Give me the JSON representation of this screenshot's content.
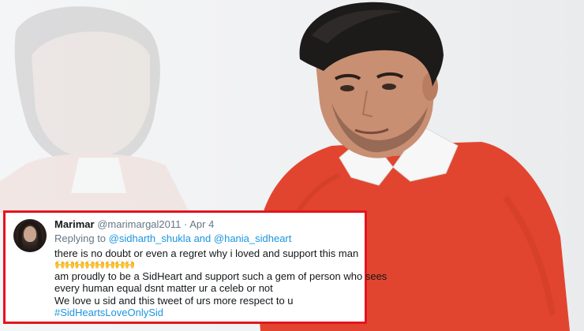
{
  "tweet": {
    "display_name": "Marimar",
    "handle": "@marimargal2011",
    "separator": "·",
    "date": "Apr 4",
    "replying_prefix": "Replying to",
    "mention_1": "@sidharth_shukla",
    "replying_joiner": "and",
    "mention_2": "@hania_sidheart",
    "line_1": "there is no doubt or even a regret why i loved and support this man",
    "emoji_row": "🙌🙌🙌🙌🙌🙌🙌🙌",
    "line_2": "am proudly to be a SidHeart and support such a gem of person who sees",
    "line_3": "every human equal dsnt matter ur a celeb or not",
    "line_4": "We love u sid and this tweet of urs more respect to u",
    "hashtag": "#SidHeartsLoveOnlySid"
  },
  "colors": {
    "card_border": "#e4141d",
    "link_blue": "#1b95e0",
    "sweater_red": "#e2452f",
    "muted_text": "#657786"
  }
}
